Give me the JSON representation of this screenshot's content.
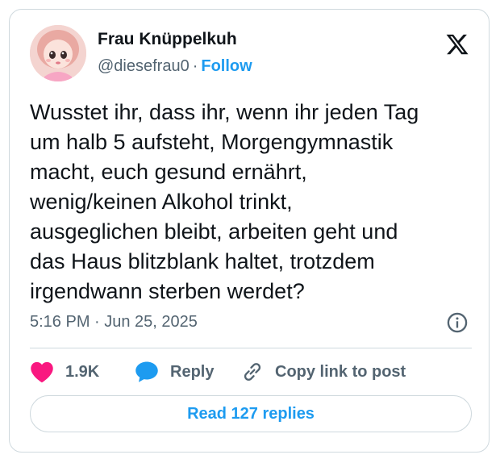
{
  "author": {
    "display_name": "Frau Knüppelkuh",
    "handle": "@diesefrau0",
    "separator": "·",
    "follow_label": "Follow",
    "avatar_icon": "doll-avatar"
  },
  "brand": {
    "logo_icon": "x-logo-icon"
  },
  "tweet": {
    "text": "Wusstet ihr, dass ihr, wenn ihr jeden Tag\num halb 5 aufsteht, Morgengymnastik\nmacht, euch gesund ernährt,\nwenig/keinen Alkohol trinkt,\nausgeglichen bleibt, arbeiten geht und\ndas Haus blitzblank haltet, trotzdem\nirgendwann sterben werdet?",
    "timestamp": "5:16 PM · Jun 25, 2025"
  },
  "actions": {
    "like_count": "1.9K",
    "reply_label": "Reply",
    "copy_link_label": "Copy link to post"
  },
  "read_replies_label": "Read 127 replies",
  "colors": {
    "accent": "#1d9bf0",
    "like": "#f91880",
    "text": "#0f1419",
    "secondary": "#536471",
    "border": "#cfd9de"
  }
}
